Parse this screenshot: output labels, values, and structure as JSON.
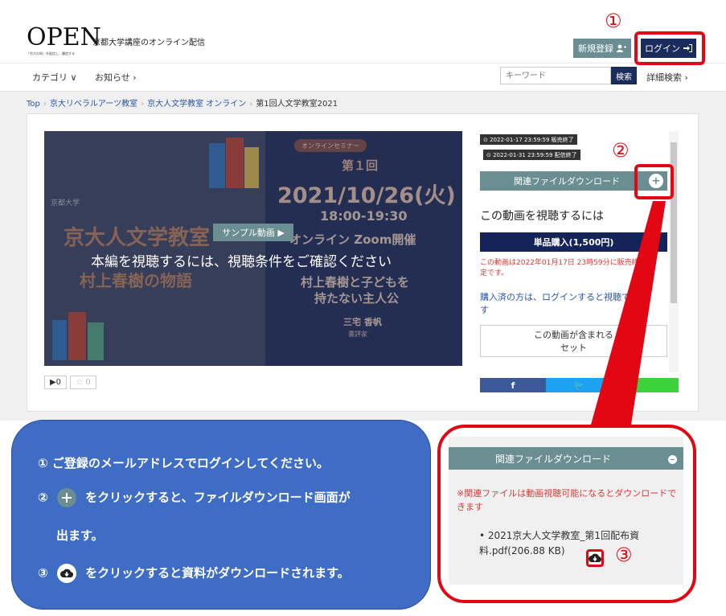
{
  "header": {
    "logo_word": "OPEN",
    "logo_sub": "京都大学講座のオンライン配信",
    "logo_tag": "「京大の知」を配信し、醸造する",
    "register_label": "新規登録",
    "login_label": "ログイン"
  },
  "nav": {
    "category": "カテゴリ ∨",
    "news": "お知らせ ›",
    "search_placeholder": "キーワード",
    "search_button": "検索",
    "advanced": "詳細検索 ›"
  },
  "breadcrumb": [
    "Top",
    "京大リベラルアーツ教室",
    "京大人文学教室 オンライン",
    "第1回人文学教室2021"
  ],
  "video": {
    "seminar_tag": "オンラインセミナー",
    "session_no": "第１回",
    "date": "2021/10/26(火)",
    "time": "18:00-19:30",
    "online": "オンライン Zoom開催",
    "topic_line1": "村上春樹と子どもを",
    "topic_line2": "持たない主人公",
    "speaker": "三宅 香帆",
    "role": "書評家",
    "kyoto_mark": "京都大学",
    "title_a": "京大人文学教室",
    "title_b": "村上春樹の物語",
    "sample_button": "サンプル動画 ▶",
    "overlay_text": "本編を視聴するには、視聴条件をご確認ください",
    "view_count": "▶0",
    "fav_count": "☆ 0"
  },
  "sidebar": {
    "sale_end": "⊙ 2022-01-17 23:59:59 販売終了",
    "delivery_end": "⊙ 2022-01-31 23:59:59 配信終了",
    "related_label": "関連ファイルダウンロード",
    "watch_heading": "この動画を視聴するには",
    "buy_label": "単品購入(1,500円)",
    "buy_note": "この動画は2022年01月17日 23時59分に販売終了予定です。",
    "login_note": "購入済の方は、ログインすると視聴できます",
    "set_line1": "この動画が含まれる",
    "set_line2": "セット",
    "share_fb": "f",
    "share_tw": "🐦"
  },
  "annotations": {
    "n1": "①",
    "n2": "②",
    "n3": "③",
    "step1": "① ご登録のメールアドレスでログインしてください。",
    "step2a": "②",
    "step2b": "をクリックすると、ファイルダウンロード画面が",
    "step2c": "出ます。",
    "step3a": "③",
    "step3b": "をクリックすると資料がダウンロードされます。"
  },
  "zoom": {
    "header": "関連ファイルダウンロード",
    "note": "※関連ファイルは動画視聴可能になるとダウンロードできます",
    "file": "• 2021京大人文学教室_第1回配布資料.pdf(206.88 KB)"
  },
  "colors": {
    "accent_teal": "#6a8e91",
    "navy": "#1a2c5c",
    "annotation_red": "#e30613",
    "callout_blue": "#3f6cc4"
  }
}
